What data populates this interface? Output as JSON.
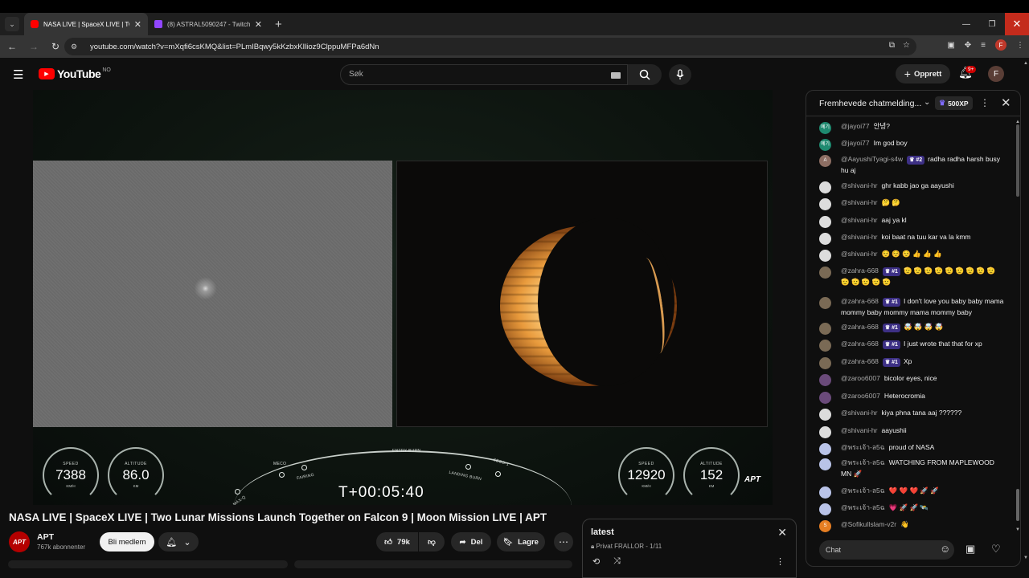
{
  "browser": {
    "tabs": [
      {
        "title": "NASA LIVE | SpaceX LIVE | Two"
      },
      {
        "title": "(8) ASTRAL5090247 - Twitch"
      }
    ],
    "url": "youtube.com/watch?v=mXqfi6csKMQ&list=PLmIBqwy5kKzbxKIlioz9ClppuMFPa6dNn",
    "profile_letter": "F"
  },
  "youtube": {
    "logo_text": "YouTube",
    "country_code": "NO",
    "search_placeholder": "Søk",
    "create_label": "Opprett",
    "notification_count": "9+",
    "avatar_letter": "F"
  },
  "video": {
    "hud": {
      "speed_label": "SPEED",
      "speed_value": "7388",
      "speed_unit": "KM/H",
      "altitude_label": "ALTITUDE",
      "altitude_value": "86.0",
      "altitude_unit": "KM",
      "speed2_label": "SPEED",
      "speed2_value": "12920",
      "speed2_unit": "KM/H",
      "altitude2_label": "ALTITUDE",
      "altitude2_value": "152",
      "altitude2_unit": "KM",
      "clock": "T+00:05:40",
      "milestones": {
        "maxq": "MAX-Q",
        "meco": "MECO",
        "fairing": "FAIRING",
        "entry_burn": "ENTRY BURN",
        "landing_burn": "LANDING BURN",
        "seco": "SECO-1"
      }
    },
    "watermark": "APT",
    "title": "NASA LIVE | SpaceX LIVE | Two Lunar Missions Launch Together on Falcon 9 | Moon Mission LIVE | APT"
  },
  "channel": {
    "avatar_text": "APT",
    "name": "APT",
    "subscribers": "767k abonnenter",
    "join_label": "Bli medlem",
    "likes": "79k",
    "share_label": "Del",
    "save_label": "Lagre"
  },
  "playlist": {
    "title": "latest",
    "subtitle": "Privat FRALLOR - 1/11"
  },
  "chat": {
    "header": "Fremhevede chatmelding...",
    "xp": "500XP",
    "input_placeholder": "Chat",
    "messages": [
      {
        "author": "@jayoi77",
        "text": "안녕?",
        "avatar": "예기",
        "avatar_color": "#1f8a70",
        "badge": ""
      },
      {
        "author": "@jayoi77",
        "text": "Im god boy",
        "avatar": "예기",
        "avatar_color": "#1f8a70",
        "badge": ""
      },
      {
        "author": "@AayushiTyagi-s4w",
        "text": "radha radha harsh busy hu aj",
        "avatar": "A",
        "avatar_color": "#8d6e63",
        "badge": "#2"
      },
      {
        "author": "@shivani-hr",
        "text": "ghr kabb jao ga aayushi",
        "avatar": "",
        "avatar_color": "#dcdcdc",
        "badge": ""
      },
      {
        "author": "@shivani-hr",
        "text": "🤔 🤔",
        "avatar": "",
        "avatar_color": "#dcdcdc",
        "badge": ""
      },
      {
        "author": "@shivani-hr",
        "text": "aaj ya kl",
        "avatar": "",
        "avatar_color": "#dcdcdc",
        "badge": ""
      },
      {
        "author": "@shivani-hr",
        "text": "koi baat na tuu kar va la kmm",
        "avatar": "",
        "avatar_color": "#dcdcdc",
        "badge": ""
      },
      {
        "author": "@shivani-hr",
        "text": "☺️ ☺️ ☺️ 👍 👍 👍",
        "avatar": "",
        "avatar_color": "#dcdcdc",
        "badge": ""
      },
      {
        "author": "@zahra-668",
        "text": "🫡 🫡 🫡 🫡 🫡 🫡 🫡 🫡 🫡 🫡 🫡 🫡 🫡 🫡",
        "avatar": "",
        "avatar_color": "#7a6a55",
        "badge": "#1"
      },
      {
        "author": "@zahra-668",
        "text": "I don't love you baby baby mama mommy baby mommy mama mommy baby",
        "avatar": "",
        "avatar_color": "#7a6a55",
        "badge": "#1"
      },
      {
        "author": "@zahra-668",
        "text": "🤯 🤯 🤯 🤯",
        "avatar": "",
        "avatar_color": "#7a6a55",
        "badge": "#1"
      },
      {
        "author": "@zahra-668",
        "text": "I just wrote that that for xp",
        "avatar": "",
        "avatar_color": "#7a6a55",
        "badge": "#1"
      },
      {
        "author": "@zahra-668",
        "text": "Xp",
        "avatar": "",
        "avatar_color": "#7a6a55",
        "badge": "#1"
      },
      {
        "author": "@zaroo6007",
        "text": "bicolor eyes, nice",
        "avatar": "",
        "avatar_color": "#6a4a7a",
        "badge": ""
      },
      {
        "author": "@zaroo6007",
        "text": "Heterocromia",
        "avatar": "",
        "avatar_color": "#6a4a7a",
        "badge": ""
      },
      {
        "author": "@shivani-hr",
        "text": "kiya phna tana aaj ??????",
        "avatar": "",
        "avatar_color": "#dcdcdc",
        "badge": ""
      },
      {
        "author": "@shivani-hr",
        "text": "aayushii",
        "avatar": "",
        "avatar_color": "#dcdcdc",
        "badge": ""
      },
      {
        "author": "@พระเจ้า-ล5ฉ",
        "text": "proud of NASA",
        "avatar": "",
        "avatar_color": "#b9c3e8",
        "badge": ""
      },
      {
        "author": "@พระเจ้า-ล5ฉ",
        "text": "WATCHING FROM MAPLEWOOD MN 🚀",
        "avatar": "",
        "avatar_color": "#b9c3e8",
        "badge": ""
      },
      {
        "author": "@พระเจ้า-ล5ฉ",
        "text": "❤️ ❤️ ❤️ 🚀 🚀",
        "avatar": "",
        "avatar_color": "#b9c3e8",
        "badge": ""
      },
      {
        "author": "@พระเจ้า-ล5ฉ",
        "text": "💗 🚀 🚀 🛰️",
        "avatar": "",
        "avatar_color": "#b9c3e8",
        "badge": ""
      },
      {
        "author": "@SofikulIslam-v2r",
        "text": "👋",
        "avatar": "S",
        "avatar_color": "#e67e22",
        "badge": ""
      }
    ]
  }
}
